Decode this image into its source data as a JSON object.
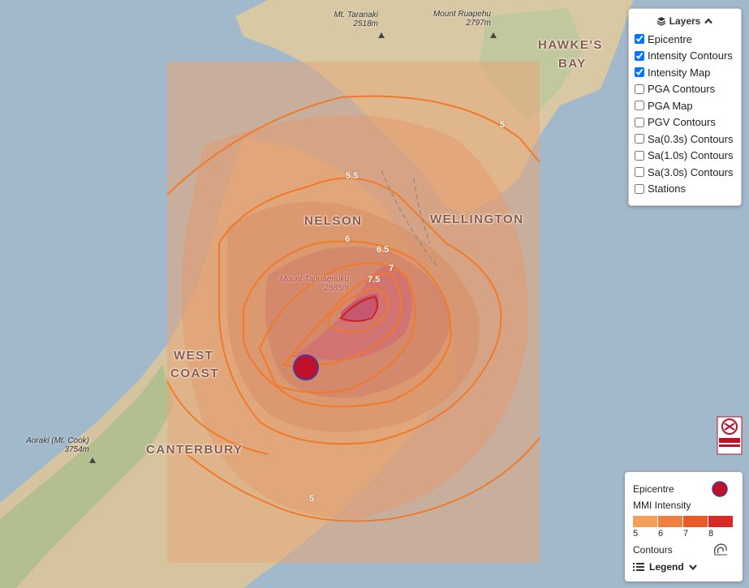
{
  "layers": {
    "title": "Layers",
    "items": [
      {
        "label": "Epicentre",
        "checked": true
      },
      {
        "label": "Intensity Contours",
        "checked": true
      },
      {
        "label": "Intensity Map",
        "checked": true
      },
      {
        "label": "PGA Contours",
        "checked": false
      },
      {
        "label": "PGA Map",
        "checked": false
      },
      {
        "label": "PGV Contours",
        "checked": false
      },
      {
        "label": "Sa(0.3s) Contours",
        "checked": false
      },
      {
        "label": "Sa(1.0s) Contours",
        "checked": false
      },
      {
        "label": "Sa(3.0s) Contours",
        "checked": false
      },
      {
        "label": "Stations",
        "checked": false
      }
    ]
  },
  "legend": {
    "epicentre_label": "Epicentre",
    "mmi_label": "MMI Intensity",
    "ticks": [
      "5",
      "6",
      "7",
      "8"
    ],
    "contours_label": "Contours",
    "toggle_label": "Legend",
    "colors": [
      "#f5a05a",
      "#f08040",
      "#e85a28",
      "#d82828"
    ]
  },
  "regions": {
    "hawkes": "HAWKE'S",
    "bay": "BAY",
    "nelson": "NELSON",
    "wellington": "WELLINGTON",
    "west": "WEST",
    "coast": "COAST",
    "canterbury": "CANTERBURY"
  },
  "peaks": {
    "taranaki_name": "Mt. Taranaki",
    "taranaki_elev": "2518m",
    "ruapehu_name": "Mount Ruapehu",
    "ruapehu_elev": "2797m",
    "tapuaenuku_name": "Mount Tapuaenuku",
    "tapuaenuku_elev": "2885m",
    "aoraki_name": "Aoraki (Mt. Cook)",
    "aoraki_elev": "3754m"
  },
  "contours": {
    "c5_top": "5",
    "c5_bottom": "5",
    "c55": "5.5",
    "c6": "6",
    "c65": "6.5",
    "c7": "7",
    "c75": "7.5"
  },
  "colors": {
    "sea": "#9fb6c9",
    "land": "#d9c9a3",
    "contour": "#f07a2a",
    "epicentre": "#c0102a"
  }
}
